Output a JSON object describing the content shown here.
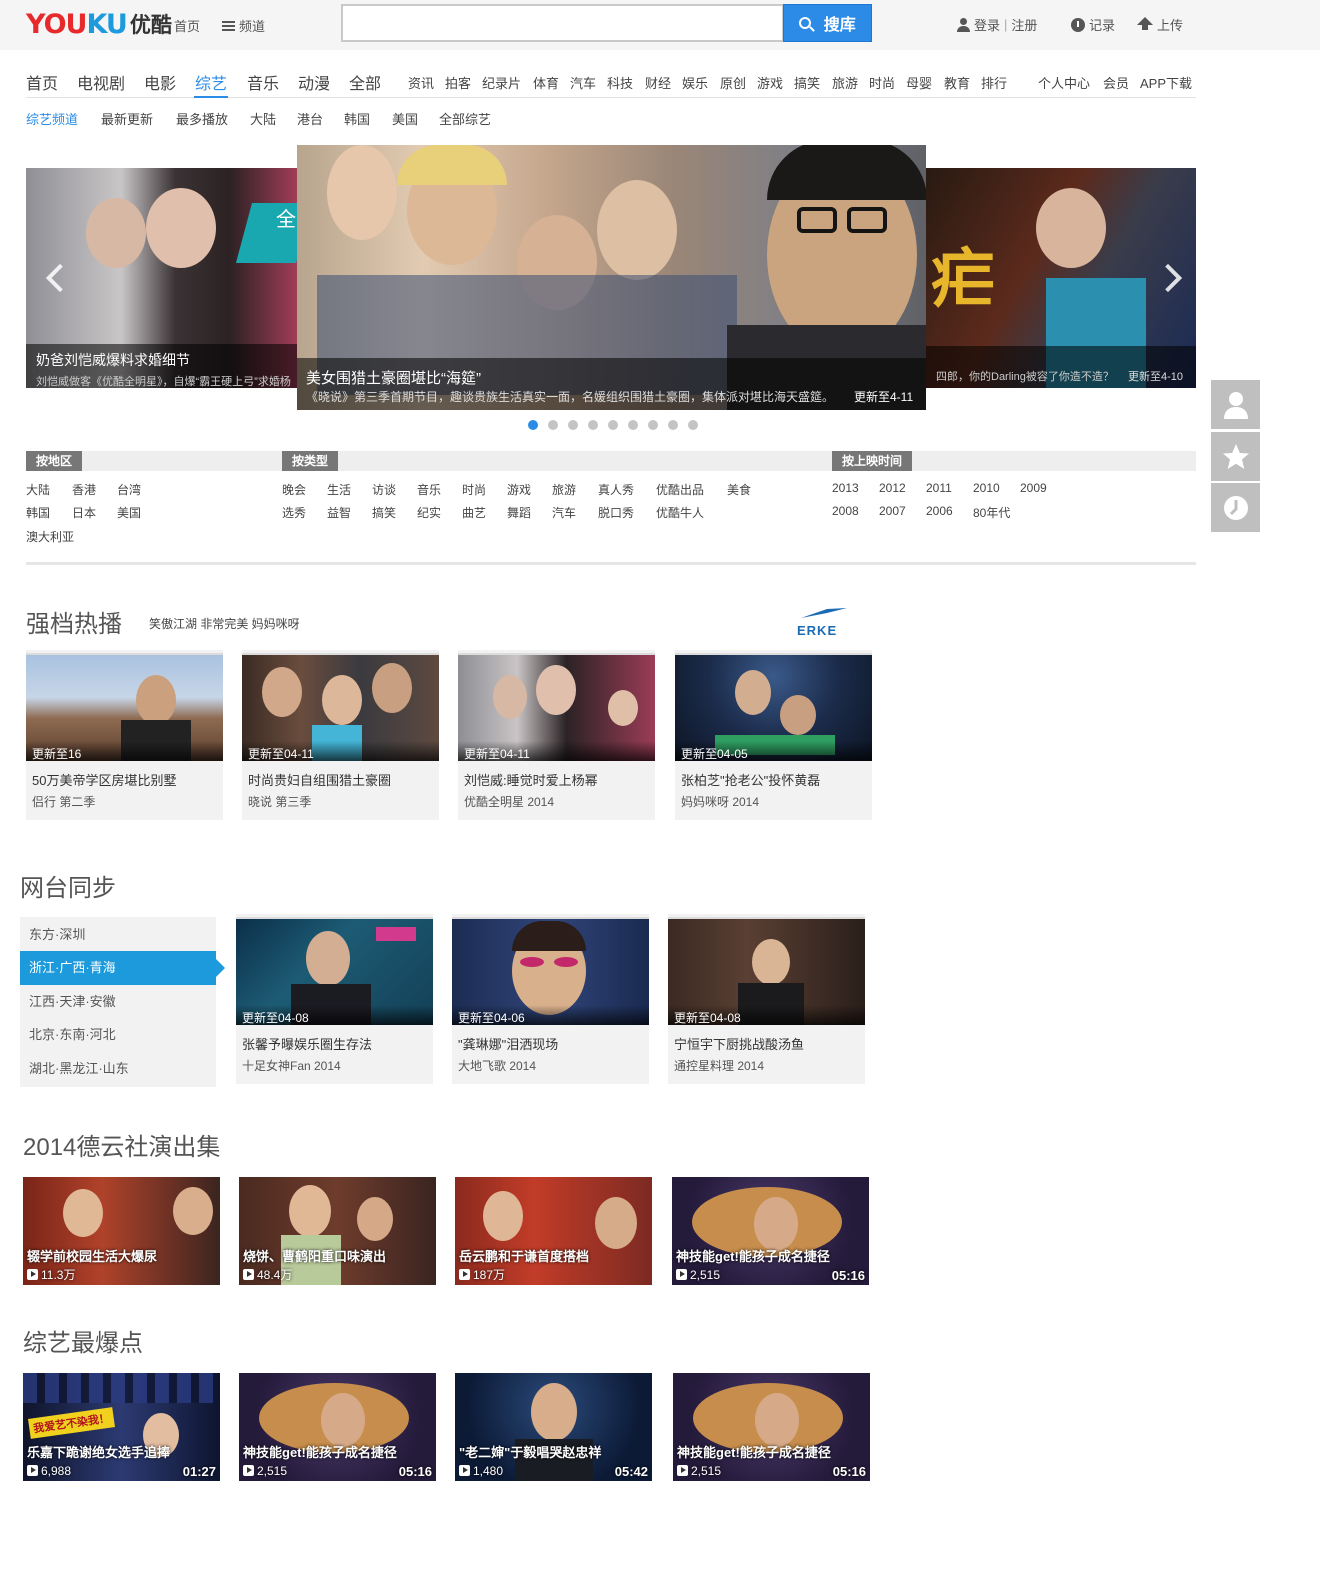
{
  "header": {
    "logo_text_1": "YOU",
    "logo_text_2": "KU",
    "logo_cn": "优酷",
    "home_label": "首页",
    "channel_label": "频道",
    "search_placeholder": "",
    "search_button": "搜库",
    "login": "登录",
    "divider": "|",
    "register": "注册",
    "history": "记录",
    "upload": "上传"
  },
  "nav": {
    "big": [
      "首页",
      "电视剧",
      "电影",
      "综艺",
      "音乐",
      "动漫",
      "全部"
    ],
    "small": [
      "资讯",
      "拍客",
      "纪录片",
      "体育",
      "汽车",
      "科技",
      "财经",
      "娱乐",
      "原创",
      "游戏",
      "搞笑",
      "旅游",
      "时尚",
      "母婴",
      "教育",
      "排行"
    ],
    "right": [
      "个人中心",
      "会员",
      "APP下载"
    ],
    "active": "综艺"
  },
  "subnav": [
    "综艺频道",
    "最新更新",
    "最多播放",
    "大陆",
    "港台",
    "韩国",
    "美国",
    "全部综艺"
  ],
  "carousel": {
    "left_title": "奶爸刘恺威爆料求婚细节",
    "left_desc": "刘恺威做客《优酷全明星》，自爆“霸王硬上弓”求婚杨",
    "main_title": "美女围猎土豪圈堪比“海筵”",
    "main_desc": "《晓说》第三季首期节目，趣谈贵族生活真实一面，名媛组织围猎土豪圈，集体派对堪比海天盛筵。",
    "main_update": "更新至4-11",
    "right_desc": "四郎，你的Darling被容了你造不造？",
    "right_update": "更新至4-10",
    "right_big_char": "疟",
    "left_overlay_char": "全",
    "dot_count": 9,
    "active_dot": 0
  },
  "filters": {
    "region_label": "按地区",
    "region_items": [
      "大陆",
      "香港",
      "台湾",
      "韩国",
      "日本",
      "美国",
      "澳大利亚"
    ],
    "type_label": "按类型",
    "type_items": [
      "晚会",
      "生活",
      "访谈",
      "音乐",
      "时尚",
      "游戏",
      "旅游",
      "真人秀",
      "优酷出品",
      "美食",
      "选秀",
      "益智",
      "搞笑",
      "纪实",
      "曲艺",
      "舞蹈",
      "汽车",
      "脱口秀",
      "优酷牛人"
    ],
    "time_label": "按上映时间",
    "time_items": [
      "2013",
      "2012",
      "2011",
      "2010",
      "2009",
      "2008",
      "2007",
      "2006",
      "80年代"
    ]
  },
  "hot": {
    "title": "强档热播",
    "tags": "笑傲江湖 非常完美 妈妈咪呀",
    "sponsor": "ERKE",
    "cards": [
      {
        "update": "更新至16",
        "title": "50万美帝学区房堪比别墅",
        "sub": "侣行 第二季"
      },
      {
        "update": "更新至04-11",
        "title": "时尚贵妇自组围猎土豪圈",
        "sub": "晓说 第三季"
      },
      {
        "update": "更新至04-11",
        "title": "刘恺威:睡觉时爱上杨幂",
        "sub": "优酷全明星 2014"
      },
      {
        "update": "更新至04-05",
        "title": "张柏芝\"抢老公\"投怀黄磊",
        "sub": "妈妈咪呀 2014"
      }
    ]
  },
  "tv": {
    "title": "网台同步",
    "list": [
      "东方·深圳",
      "浙江·广西·青海",
      "江西·天津·安徽",
      "北京·东南·河北",
      "湖北·黑龙江·山东"
    ],
    "active_index": 1,
    "cards": [
      {
        "update": "更新至04-08",
        "title": "张馨予曝娱乐圈生存法",
        "sub": "十足女神Fan 2014"
      },
      {
        "update": "更新至04-06",
        "title": "\"龚琳娜\"泪洒现场",
        "sub": "大地飞歌 2014"
      },
      {
        "update": "更新至04-08",
        "title": "宁恒宇下厨挑战酸汤鱼",
        "sub": "通控星料理 2014"
      }
    ]
  },
  "deyun": {
    "title": "2014德云社演出集",
    "cards": [
      {
        "title": "辍学前校园生活大爆尿",
        "plays": "11.3万",
        "duration": ""
      },
      {
        "title": "烧饼、曹鹤阳重口味演出",
        "plays": "48.4万",
        "duration": ""
      },
      {
        "title": "岳云鹏和于谦首度搭档",
        "plays": "187万",
        "duration": ""
      },
      {
        "title": "神技能get!能孩子成名捷径",
        "plays": "2,515",
        "duration": "05:16"
      }
    ]
  },
  "hotspot": {
    "title": "综艺最爆点",
    "cards": [
      {
        "title": "乐嘉下跪谢绝女选手追捧",
        "plays": "6,988",
        "duration": "01:27",
        "banner": "我爱艺不染我！"
      },
      {
        "title": "神技能get!能孩子成名捷径",
        "plays": "2,515",
        "duration": "05:16"
      },
      {
        "title": "\"老二婶\"于毅唱哭赵忠祥",
        "plays": "1,480",
        "duration": "05:42"
      },
      {
        "title": "神技能get!能孩子成名捷径",
        "plays": "2,515",
        "duration": "05:16"
      }
    ]
  },
  "side_buttons": [
    "user-icon",
    "star-icon",
    "clock-icon"
  ],
  "colors": {
    "accent": "#2b8be6",
    "youku_red": "#e8292b",
    "youku_blue": "#1c9adb"
  }
}
